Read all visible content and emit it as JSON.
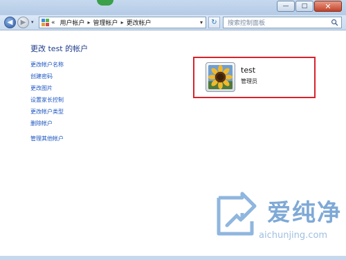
{
  "window": {
    "min_glyph": "—",
    "max_glyph": "□",
    "close_glyph": "✕"
  },
  "nav": {
    "back_glyph": "◀",
    "forward_glyph": "▶",
    "dropdown_glyph": "▾"
  },
  "address": {
    "prefix": "«",
    "breadcrumbs": [
      "用户帐户",
      "管理帐户",
      "更改帐户"
    ],
    "separator": "▸",
    "dropdown_glyph": "▾"
  },
  "refresh_glyph": "↻",
  "search": {
    "placeholder": "搜索控制面板"
  },
  "page": {
    "title": "更改 test 的帐户"
  },
  "tasks": [
    "更改帐户名称",
    "创建密码",
    "更改图片",
    "设置家长控制",
    "更改帐户类型",
    "删除帐户"
  ],
  "extra_task": "管理其他帐户",
  "account": {
    "name": "test",
    "type": "管理员"
  },
  "watermark": {
    "brand": "爱纯净",
    "url": "aichunjing.com"
  },
  "colors": {
    "link": "#1b56c2",
    "title": "#1e3b8c",
    "highlight_border": "#d8222a"
  }
}
